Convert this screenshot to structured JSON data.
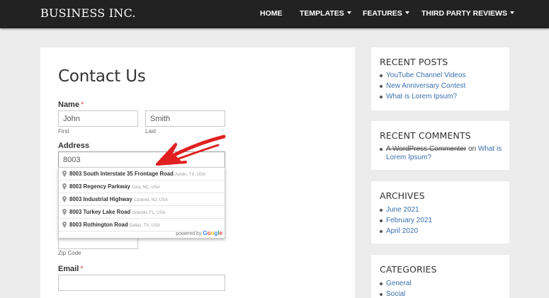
{
  "header": {
    "brand": "BUSINESS INC.",
    "nav": [
      {
        "label": "HOME",
        "dropdown": false
      },
      {
        "label": "TEMPLATES",
        "dropdown": true
      },
      {
        "label": "FEATURES",
        "dropdown": true
      },
      {
        "label": "THIRD PARTY REVIEWS",
        "dropdown": true
      }
    ]
  },
  "form": {
    "title": "Contact Us",
    "name_label": "Name",
    "required_mark": "*",
    "first_value": "John",
    "first_sublabel": "First",
    "last_value": "Smith",
    "last_sublabel": "Last",
    "address_label": "Address",
    "address_value": "8003",
    "zip_sublabel": "Zip Code",
    "email_label": "Email",
    "email_value": ""
  },
  "autocomplete": {
    "suggestions": [
      {
        "main": "8003 South Interstate 35 Frontage Road",
        "secondary": "Austin, TX, USA"
      },
      {
        "main": "8003 Regency Parkway",
        "secondary": "Cary, NC, USA"
      },
      {
        "main": "8003 Industrial Highway",
        "secondary": "Carteret, NJ, USA"
      },
      {
        "main": "8003 Turkey Lake Road",
        "secondary": "Orlando, FL, USA"
      },
      {
        "main": "8003 Rothington Road",
        "secondary": "Dallas, TX, USA"
      }
    ],
    "powered_by": "powered by",
    "google": [
      "G",
      "o",
      "o",
      "g",
      "l",
      "e"
    ]
  },
  "sidebar": {
    "recent_posts": {
      "title": "RECENT POSTS",
      "items": [
        "YouTube Channel Videos",
        "New Anniversary Contest",
        "What is Lorem Ipsum?"
      ]
    },
    "recent_comments": {
      "title": "RECENT COMMENTS",
      "author": "A WordPress Commenter",
      "on": "on",
      "post_line1": "What is",
      "post_line2": "Lorem Ipsum?"
    },
    "archives": {
      "title": "ARCHIVES",
      "items": [
        "June 2021",
        "February 2021",
        "April 2020"
      ]
    },
    "categories": {
      "title": "CATEGORIES",
      "items": [
        "General",
        "Social"
      ]
    }
  },
  "colors": {
    "annotation_arrow": "#e02020",
    "link": "#3a6fae",
    "topbar": "#222222"
  }
}
